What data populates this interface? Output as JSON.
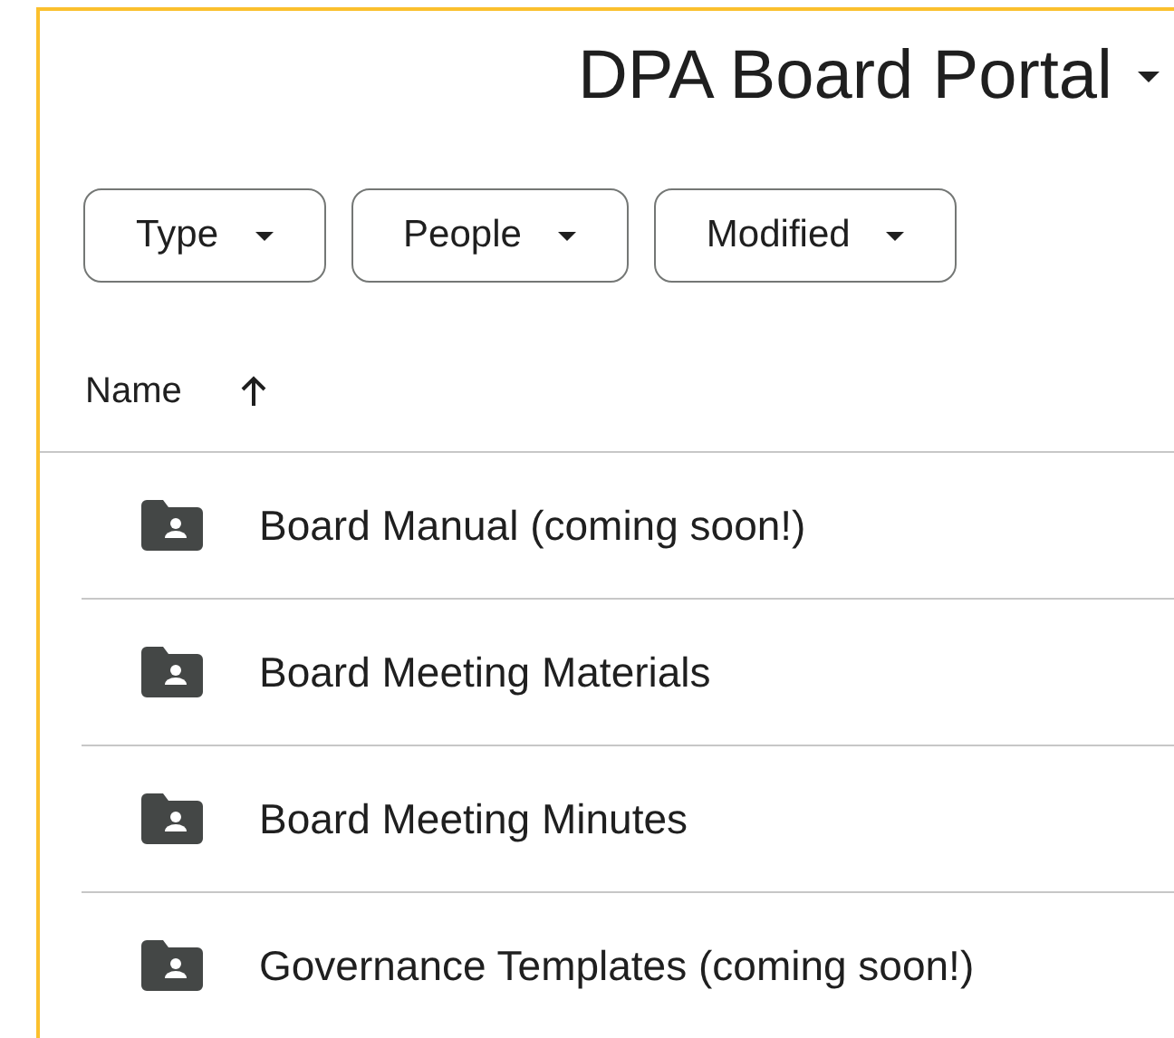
{
  "title": "DPA Board Portal",
  "filters": [
    "Type",
    "People",
    "Modified"
  ],
  "table": {
    "column": "Name",
    "sort_ascending": true,
    "rows": [
      {
        "name": "Board Manual (coming soon!)"
      },
      {
        "name": "Board Meeting Materials"
      },
      {
        "name": "Board Meeting Minutes"
      },
      {
        "name": "Governance Templates (coming soon!)"
      }
    ]
  }
}
